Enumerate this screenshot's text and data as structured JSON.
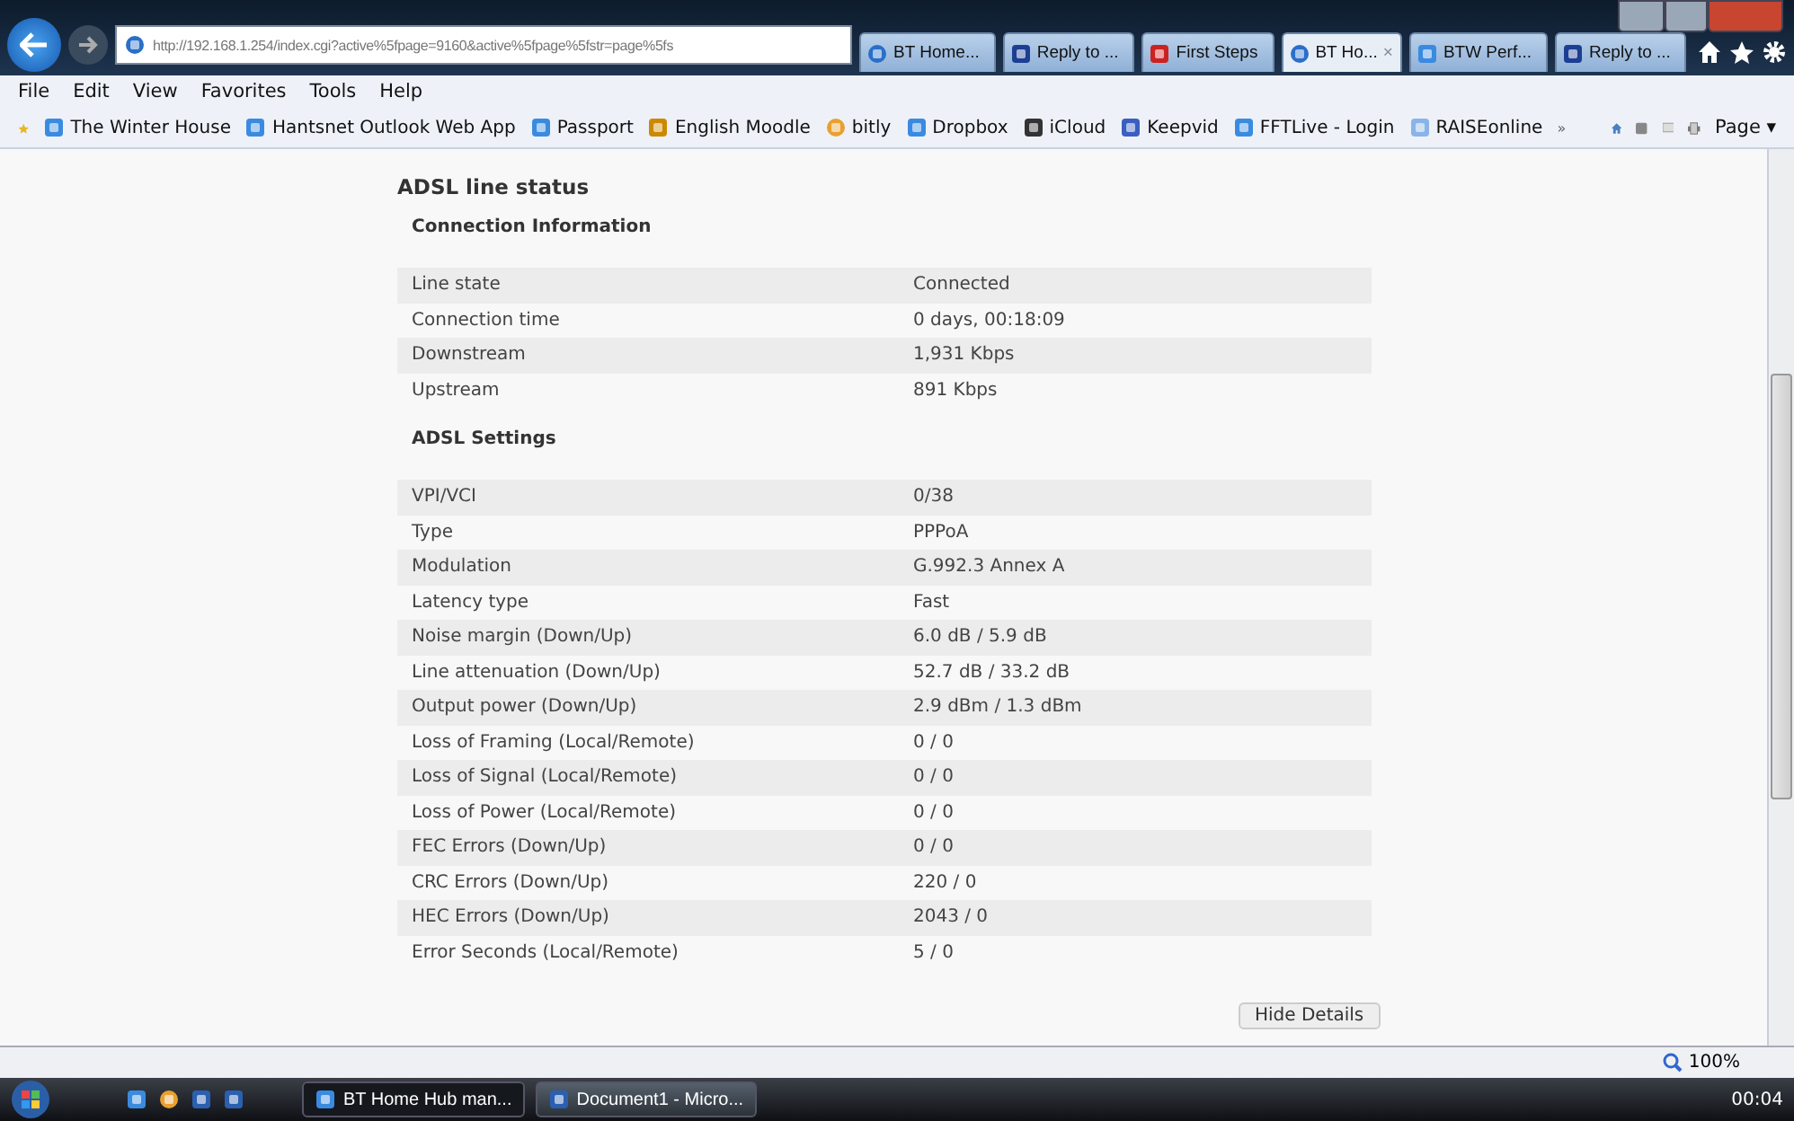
{
  "browser": {
    "address": "http://192.168.1.254/index.cgi?active%5fpage=9160&active%5fpage%5fstr=page%5fs",
    "tabs": [
      {
        "label": "BT Home...",
        "kind": "globe",
        "selected": false
      },
      {
        "label": "Reply to ...",
        "kind": "bt",
        "selected": false
      },
      {
        "label": "First Steps",
        "kind": "lifebuoy",
        "selected": false
      },
      {
        "label": "BT Ho...",
        "kind": "globe",
        "selected": true,
        "close": "×"
      },
      {
        "label": "BTW Perf...",
        "kind": "ie",
        "selected": false
      },
      {
        "label": "Reply to ...",
        "kind": "bt",
        "selected": false
      }
    ],
    "menu": [
      "File",
      "Edit",
      "View",
      "Favorites",
      "Tools",
      "Help"
    ],
    "favorites": [
      {
        "label": "The Winter House",
        "kind": "ie"
      },
      {
        "label": "Hantsnet Outlook Web App",
        "kind": "ie"
      },
      {
        "label": "Passport",
        "kind": "ie"
      },
      {
        "label": "English Moodle",
        "kind": "tm"
      },
      {
        "label": "bitly",
        "kind": "fish"
      },
      {
        "label": "Dropbox",
        "kind": "ie"
      },
      {
        "label": "iCloud",
        "kind": "apple"
      },
      {
        "label": "Keepvid",
        "kind": "kv"
      },
      {
        "label": "FFTLive - Login",
        "kind": "ie"
      },
      {
        "label": "RAISEonline",
        "kind": "ro"
      }
    ],
    "more": "»",
    "page_menu": "Page ▾"
  },
  "page": {
    "title": "ADSL line status",
    "sections": [
      {
        "heading": "Connection Information",
        "rows": [
          [
            "Line state",
            "Connected"
          ],
          [
            "Connection time",
            "0 days, 00:18:09"
          ],
          [
            "Downstream",
            "1,931 Kbps"
          ],
          [
            "Upstream",
            "891 Kbps"
          ]
        ]
      },
      {
        "heading": "ADSL Settings",
        "rows": [
          [
            "VPI/VCI",
            "0/38"
          ],
          [
            "Type",
            "PPPoA"
          ],
          [
            "Modulation",
            "G.992.3 Annex A"
          ],
          [
            "Latency type",
            "Fast"
          ],
          [
            "Noise margin (Down/Up)",
            "6.0 dB / 5.9 dB"
          ],
          [
            "Line attenuation (Down/Up)",
            "52.7 dB / 33.2 dB"
          ],
          [
            "Output power (Down/Up)",
            "2.9 dBm / 1.3 dBm"
          ],
          [
            "Loss of Framing (Local/Remote)",
            "0 / 0"
          ],
          [
            "Loss of Signal (Local/Remote)",
            "0 / 0"
          ],
          [
            "Loss of Power (Local/Remote)",
            "0 / 0"
          ],
          [
            "FEC Errors (Down/Up)",
            "0 / 0"
          ],
          [
            "CRC Errors (Down/Up)",
            "220 / 0"
          ],
          [
            "HEC Errors (Down/Up)",
            "2043 / 0"
          ],
          [
            "Error Seconds (Local/Remote)",
            "5 / 0"
          ]
        ]
      }
    ],
    "button": "Hide Details"
  },
  "status_bar": {
    "zoom": "100%"
  },
  "taskbar": {
    "windows": [
      {
        "label": "BT Home Hub man...",
        "kind": "ie",
        "selected": true
      },
      {
        "label": "Document1 - Micro...",
        "kind": "doc",
        "selected": false
      }
    ],
    "clock": "00:04"
  }
}
